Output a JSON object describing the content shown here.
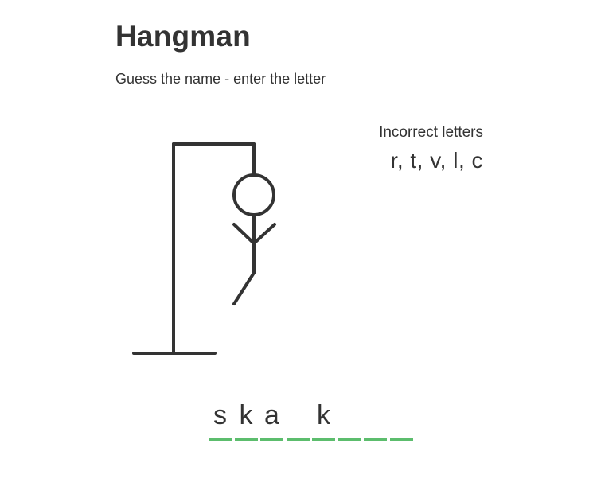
{
  "header": {
    "title": "Hangman",
    "subtitle": "Guess the name - enter the letter"
  },
  "incorrect": {
    "label": "Incorrect letters",
    "letters": "r, t, v, l, c"
  },
  "word": {
    "slots": [
      "s",
      "k",
      "a",
      "",
      "k",
      "",
      "",
      ""
    ]
  },
  "figure": {
    "wrong_guess_count": 5,
    "parts_drawn": [
      "head",
      "body",
      "left-arm",
      "right-arm",
      "left-leg"
    ]
  },
  "colors": {
    "text": "#333333",
    "underline": "#5cbd6d",
    "stroke": "#333333"
  }
}
